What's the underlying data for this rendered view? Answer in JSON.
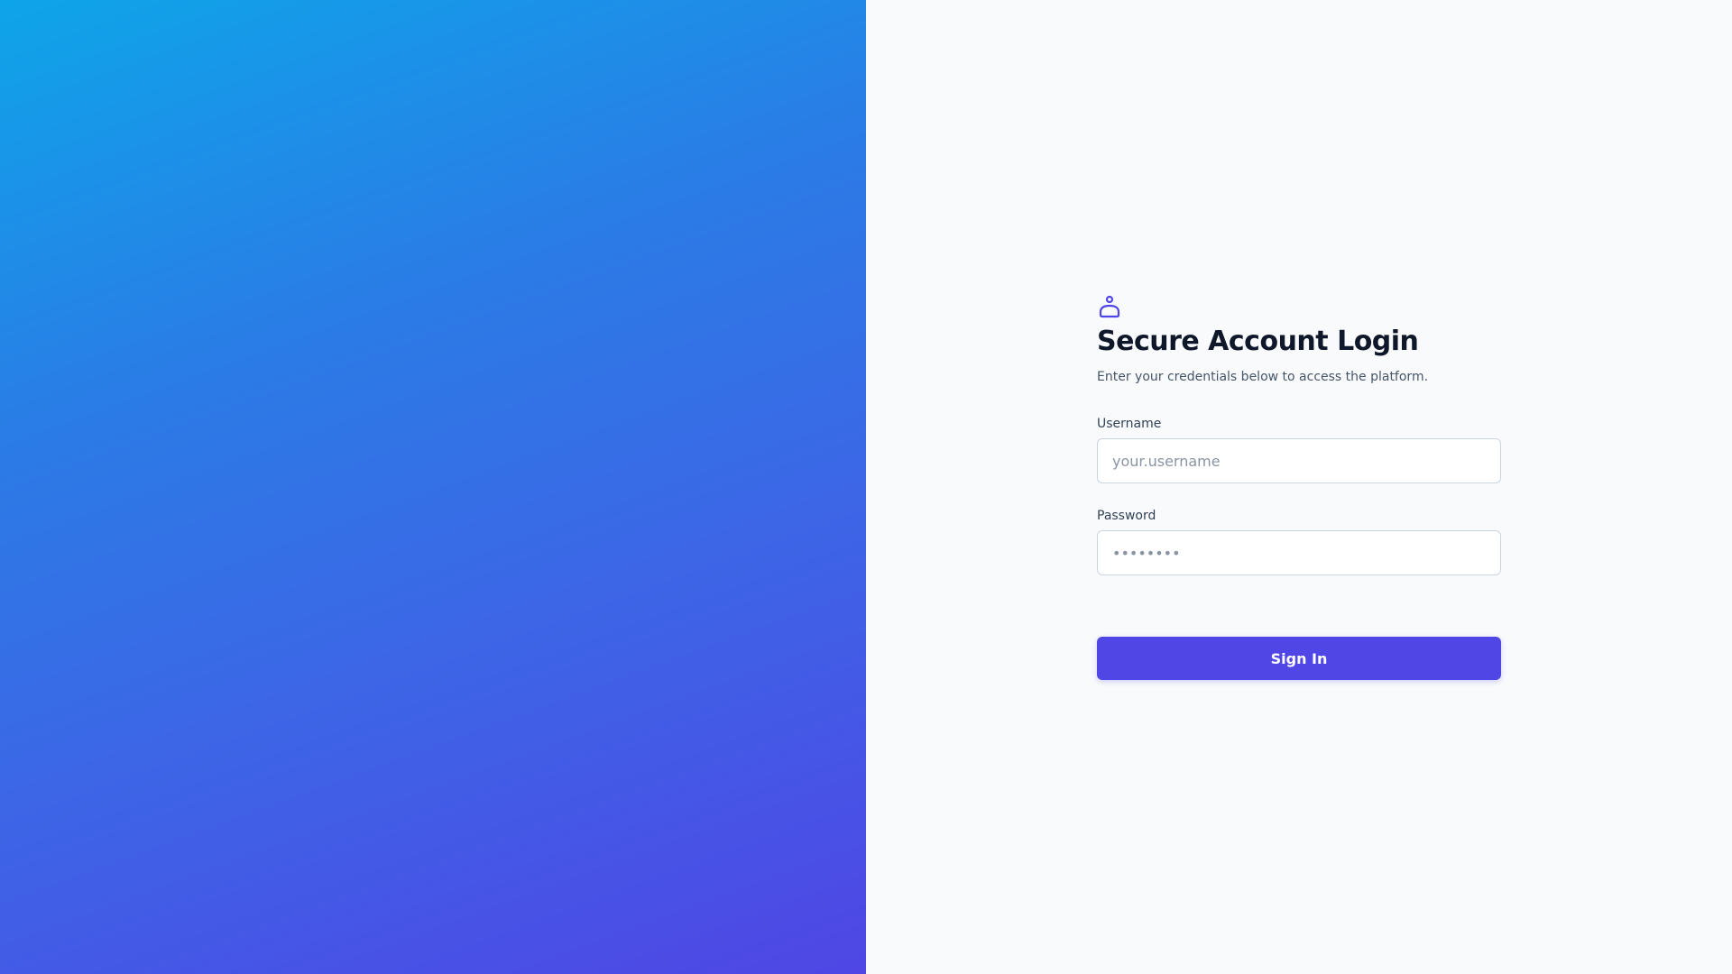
{
  "brand": {
    "gradient_start": "#0ea5e9",
    "gradient_end": "#4f46e5"
  },
  "login": {
    "icon": "user-icon",
    "title": "Secure Account Login",
    "subtitle": "Enter your credentials below to access the platform.",
    "username_label": "Username",
    "username_placeholder": "your.username",
    "username_value": "",
    "password_label": "Password",
    "password_placeholder": "••••••••",
    "password_value": "",
    "submit_label": "Sign In",
    "accent_color": "#4f46e5"
  }
}
